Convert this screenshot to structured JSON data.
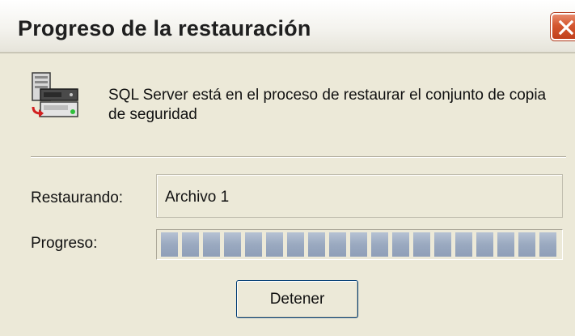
{
  "window": {
    "title": "Progreso de la restauración"
  },
  "message": {
    "text": "SQL Server está en el proceso de restaurar el conjunto de copia de seguridad"
  },
  "restoring": {
    "label": "Restaurando:",
    "value": "Archivo 1"
  },
  "progress": {
    "label": "Progreso:",
    "fraction": 1.0
  },
  "buttons": {
    "stop_label": "Detener"
  },
  "icons": {
    "dialog_icon": "database-server-icon",
    "close_icon": "close-icon"
  },
  "colors": {
    "close_button": "#d4572f",
    "progress_fill": "#9aa9c0",
    "window_background": "#ece9d8"
  }
}
